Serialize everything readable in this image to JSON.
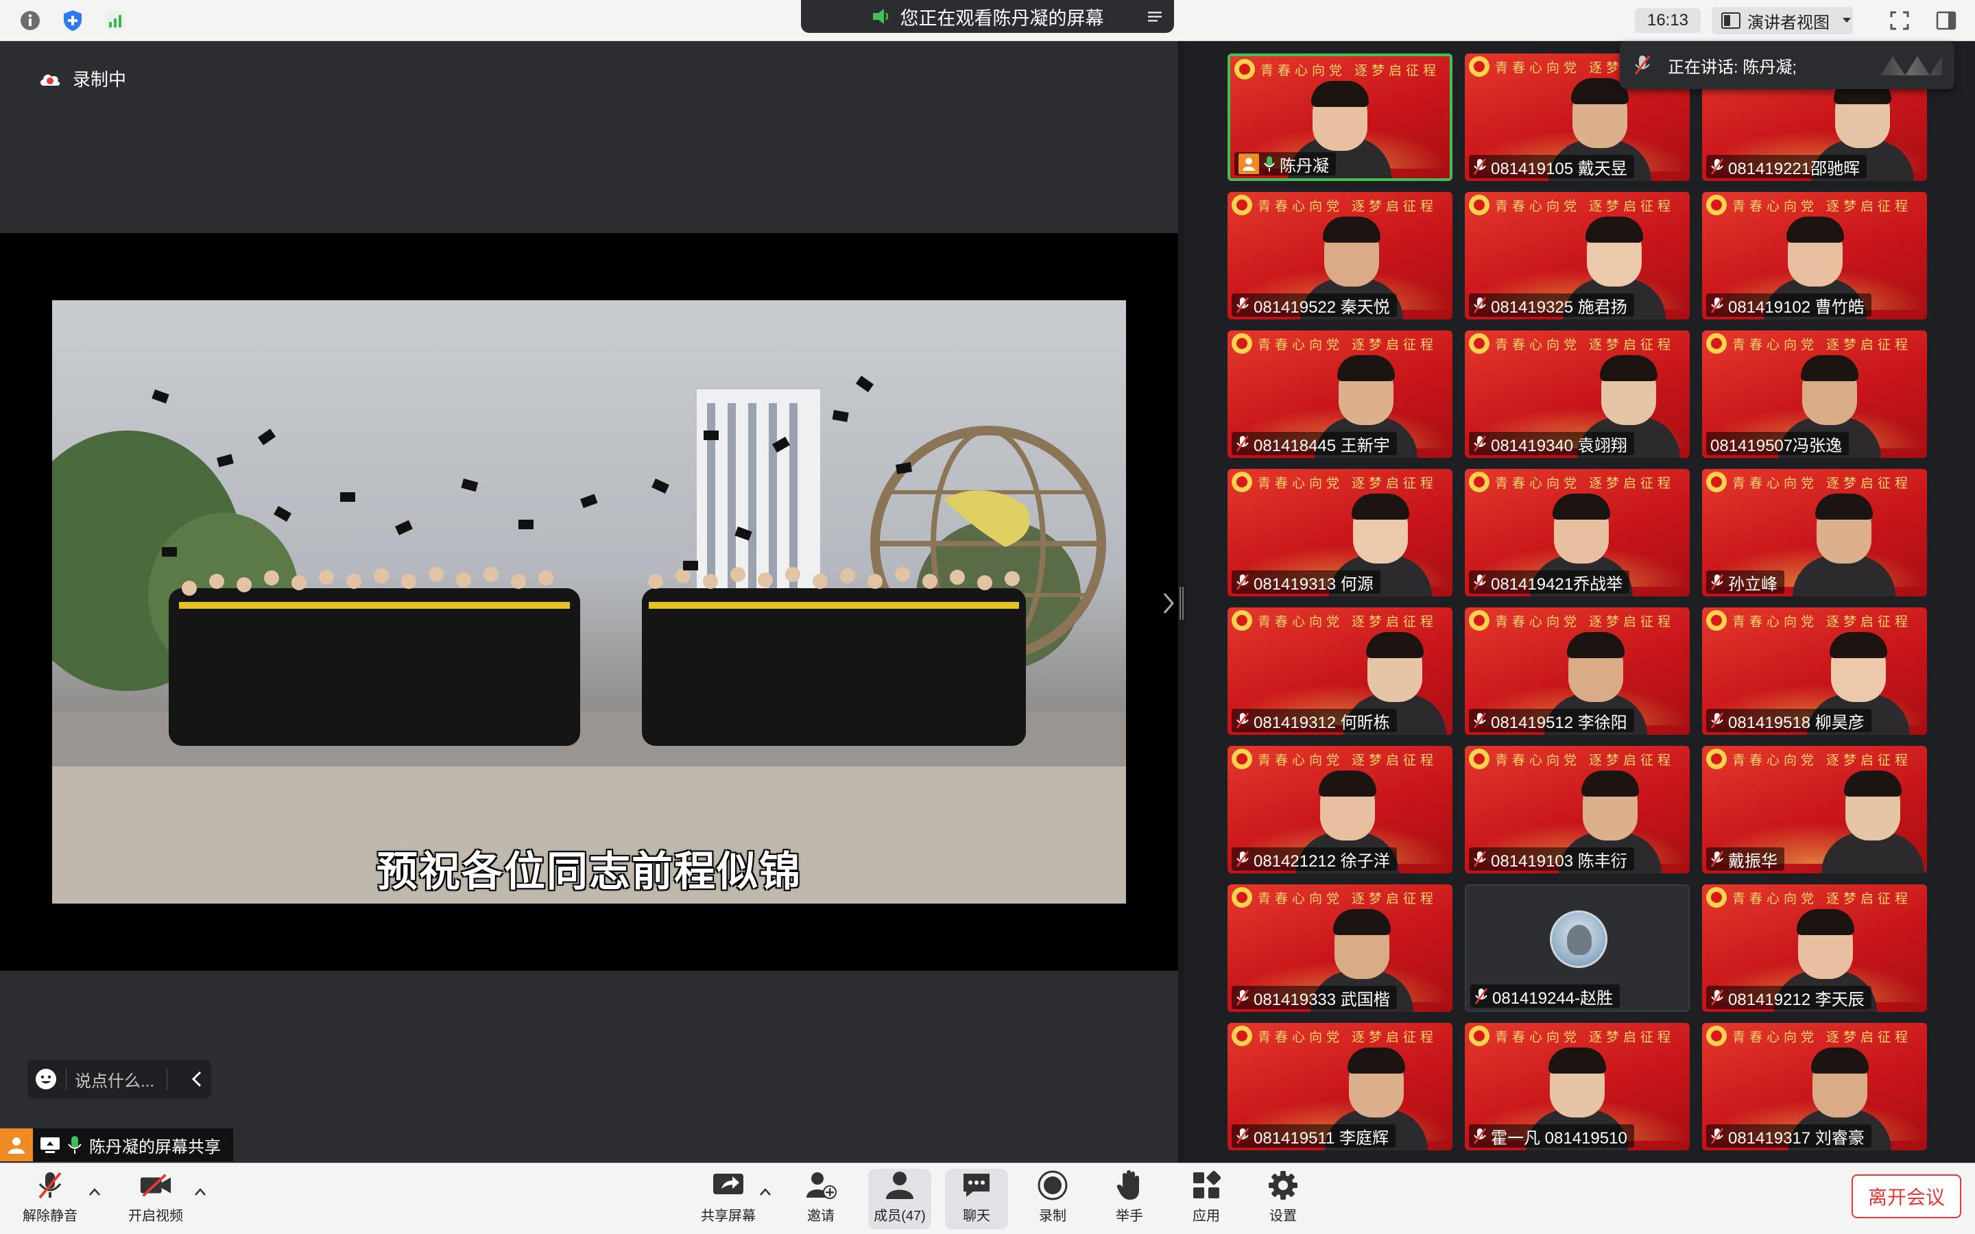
{
  "topbar": {
    "viewing_text": "您正在观看陈丹凝的屏幕",
    "clock": "16:13",
    "view_mode": "演讲者视图"
  },
  "stage": {
    "recording_label": "录制中",
    "caption": "预祝各位同志前程似锦",
    "chat_placeholder": "说点什么...",
    "share_label": "陈丹凝的屏幕共享"
  },
  "speaking": {
    "text": "正在讲话: 陈丹凝;"
  },
  "tiles": [
    {
      "name": "陈丹凝",
      "host": true,
      "active": true,
      "mic": "on"
    },
    {
      "name": "081419105 戴天昱",
      "mic": "muted"
    },
    {
      "name": "081419221邵驰晖",
      "mic": "muted"
    },
    {
      "name": "081419522 秦天悦",
      "mic": "muted"
    },
    {
      "name": "081419325 施君扬",
      "mic": "muted"
    },
    {
      "name": "081419102 曹竹皓",
      "mic": "muted"
    },
    {
      "name": "081418445 王新宇",
      "mic": "muted"
    },
    {
      "name": "081419340 袁翊翔",
      "mic": "muted"
    },
    {
      "name": "081419507冯张逸",
      "mic": "none"
    },
    {
      "name": "081419313 何源",
      "mic": "muted"
    },
    {
      "name": "081419421乔战举",
      "mic": "muted"
    },
    {
      "name": "孙立峰",
      "mic": "muted"
    },
    {
      "name": "081419312 何昕栋",
      "mic": "muted"
    },
    {
      "name": "081419512 李徐阳",
      "mic": "muted"
    },
    {
      "name": "081419518 柳昊彦",
      "mic": "muted"
    },
    {
      "name": "081421212 徐子洋",
      "mic": "muted"
    },
    {
      "name": "081419103 陈丰衍",
      "mic": "muted"
    },
    {
      "name": "戴振华",
      "mic": "muted"
    },
    {
      "name": "081419333 武国楷",
      "mic": "muted"
    },
    {
      "name": "081419244-赵胜",
      "mic": "muted",
      "avatar": true
    },
    {
      "name": "081419212 李天辰",
      "mic": "muted"
    },
    {
      "name": "081419511 李庭辉",
      "mic": "muted"
    },
    {
      "name": "霍一凡 081419510",
      "mic": "muted"
    },
    {
      "name": "081419317 刘睿豪",
      "mic": "muted"
    }
  ],
  "tile_banner": "青春心向党  逐梦启征程",
  "toolbar": {
    "unmute": "解除静音",
    "start_video": "开启视频",
    "share_screen": "共享屏幕",
    "invite": "邀请",
    "participants": "成员(47)",
    "chat": "聊天",
    "record": "录制",
    "raise_hand": "举手",
    "apps": "应用",
    "settings": "设置",
    "leave": "离开会议"
  },
  "colors": {
    "accent_orange": "#f08a24",
    "speaking_green": "#40c057",
    "leave_red": "#e53935",
    "tile_red": "#c8151a"
  }
}
